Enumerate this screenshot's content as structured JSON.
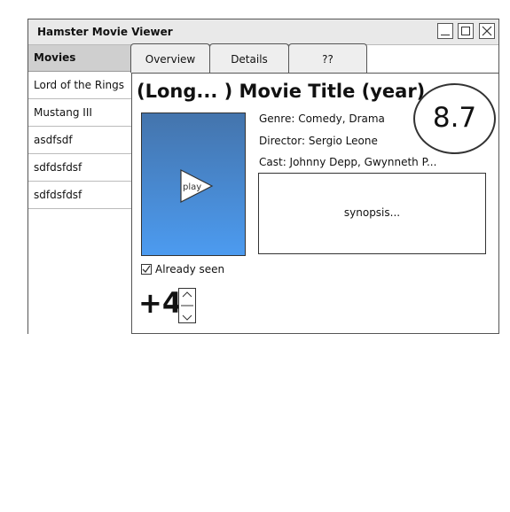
{
  "window": {
    "title": "Hamster Movie Viewer"
  },
  "sidebar": {
    "header": "Movies",
    "items": [
      {
        "label": "Lord of the Rings"
      },
      {
        "label": "Mustang III"
      },
      {
        "label": "asdfsdf"
      },
      {
        "label": "sdfdsfdsf"
      },
      {
        "label": "sdfdsfdsf"
      }
    ]
  },
  "tabs": [
    {
      "label": "Overview"
    },
    {
      "label": "Details"
    },
    {
      "label": "??"
    }
  ],
  "movie": {
    "title": "(Long... ) Movie Title (year)",
    "rating": "8.7",
    "genre": "Genre: Comedy, Drama",
    "director": "Director: Sergio Leone",
    "cast": "Cast: Johnny Depp, Gwynneth P...",
    "synopsis": "synopsis...",
    "play_label": "play",
    "already_seen_label": "Already seen",
    "already_seen_checked": true,
    "count": "+4"
  },
  "icons": {
    "play": "play-icon",
    "minimize": "minimize-icon",
    "maximize": "maximize-icon",
    "close": "close-icon",
    "checkbox": "checkmark-icon",
    "stepper_up": "chevron-up-icon",
    "stepper_down": "chevron-down-icon"
  }
}
